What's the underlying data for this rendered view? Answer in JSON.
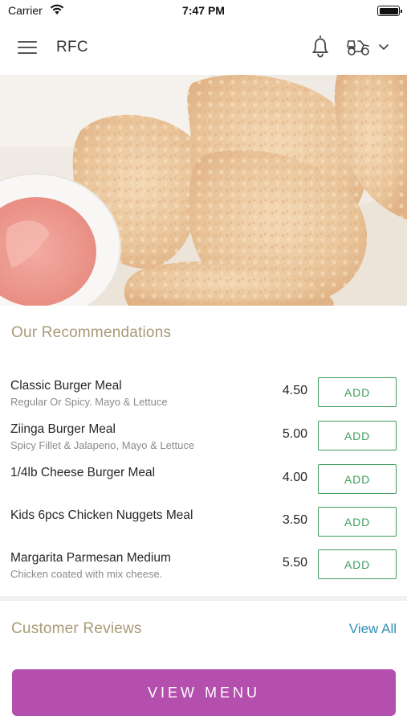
{
  "status_bar": {
    "carrier": "Carrier",
    "time": "7:47 PM"
  },
  "header": {
    "title": "RFC"
  },
  "hero": {
    "description": "photo of fried chicken with dipping sauce"
  },
  "recommendations": {
    "title": "Our Recommendations",
    "add_label": "ADD",
    "items": [
      {
        "name": "Classic Burger Meal",
        "desc": "Regular Or Spicy. Mayo & Lettuce",
        "price": "4.50"
      },
      {
        "name": "Ziinga Burger Meal",
        "desc": "Spicy Fillet & Jalapeno, Mayo & Lettuce",
        "price": "5.00"
      },
      {
        "name": "1/4lb Cheese Burger Meal",
        "desc": "",
        "price": "4.00"
      },
      {
        "name": "Kids 6pcs Chicken Nuggets Meal",
        "desc": "",
        "price": "3.50"
      },
      {
        "name": "Margarita Parmesan Medium",
        "desc": "Chicken coated with mix cheese.",
        "price": "5.50"
      }
    ]
  },
  "reviews": {
    "title": "Customer Reviews",
    "view_all": "View All"
  },
  "footer": {
    "view_menu": "VIEW MENU"
  },
  "colors": {
    "accent_purple": "#b44fae",
    "add_green": "#3f9d5a",
    "section_gold": "#a89a77",
    "link_blue": "#2f8fb6"
  }
}
